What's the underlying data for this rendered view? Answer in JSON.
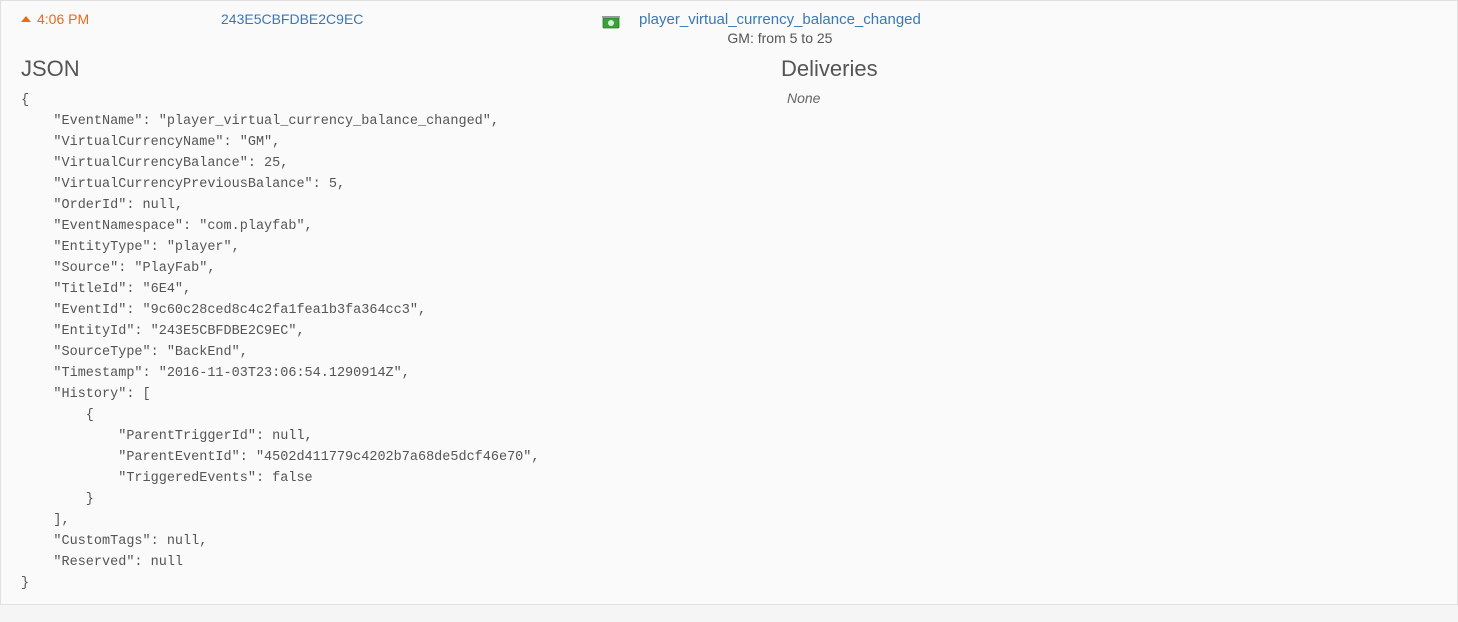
{
  "row": {
    "time": "4:06 PM",
    "entity_id": "243E5CBFDBE2C9EC",
    "event_name": "player_virtual_currency_balance_changed",
    "event_desc": "GM: from 5 to 25"
  },
  "json_section": {
    "title": "JSON",
    "body": "{\n    \"EventName\": \"player_virtual_currency_balance_changed\",\n    \"VirtualCurrencyName\": \"GM\",\n    \"VirtualCurrencyBalance\": 25,\n    \"VirtualCurrencyPreviousBalance\": 5,\n    \"OrderId\": null,\n    \"EventNamespace\": \"com.playfab\",\n    \"EntityType\": \"player\",\n    \"Source\": \"PlayFab\",\n    \"TitleId\": \"6E4\",\n    \"EventId\": \"9c60c28ced8c4c2fa1fea1b3fa364cc3\",\n    \"EntityId\": \"243E5CBFDBE2C9EC\",\n    \"SourceType\": \"BackEnd\",\n    \"Timestamp\": \"2016-11-03T23:06:54.1290914Z\",\n    \"History\": [\n        {\n            \"ParentTriggerId\": null,\n            \"ParentEventId\": \"4502d411779c4202b7a68de5dcf46e70\",\n            \"TriggeredEvents\": false\n        }\n    ],\n    \"CustomTags\": null,\n    \"Reserved\": null\n}"
  },
  "deliveries_section": {
    "title": "Deliveries",
    "none_text": "None"
  }
}
